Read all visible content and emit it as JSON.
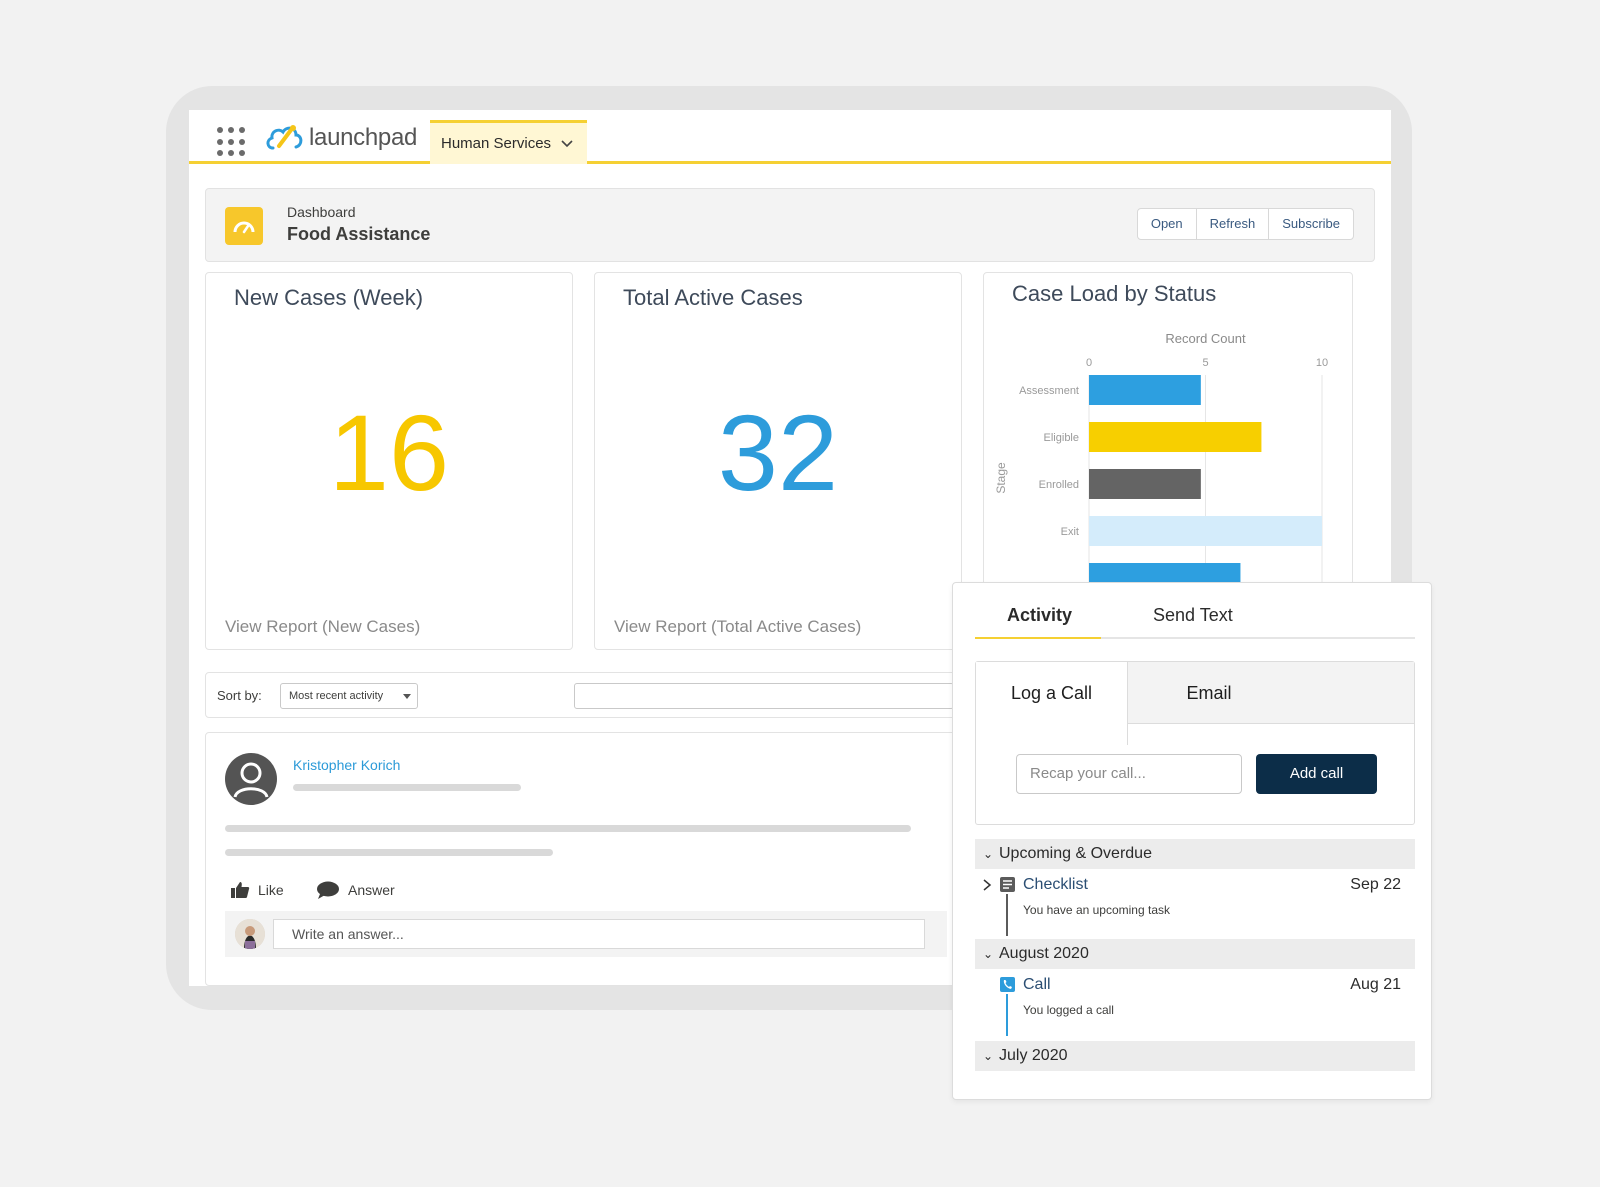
{
  "header": {
    "logo_text": "launchpad",
    "app_tab": "Human Services"
  },
  "dashboard": {
    "subtitle": "Dashboard",
    "title": "Food Assistance",
    "buttons": [
      "Open",
      "Refresh",
      "Subscribe"
    ]
  },
  "metrics": [
    {
      "title": "New Cases (Week)",
      "value": "16",
      "link": "View Report (New Cases)",
      "color": "#f7c700"
    },
    {
      "title": "Total Active Cases",
      "value": "32",
      "link": "View Report (Total Active Cases)",
      "color": "#2d9cdb"
    }
  ],
  "chart_data": {
    "type": "bar",
    "orientation": "horizontal",
    "title": "Case Load by Status",
    "xlabel": "Record Count",
    "ylabel": "Stage",
    "xlim": [
      0,
      10
    ],
    "xticks": [
      "0",
      "5",
      "10"
    ],
    "categories": [
      "Assessment",
      "Eligible",
      "Enrolled",
      "Exit",
      ""
    ],
    "values": [
      4.8,
      7.4,
      4.8,
      10,
      6.5
    ],
    "colors": [
      "#2d9fe0",
      "#f7cf00",
      "#646464",
      "#d4ecfb",
      "#2d9fe0"
    ],
    "grid": true
  },
  "feed": {
    "sort_label": "Sort by:",
    "sort_value": "Most recent activity",
    "author": "Kristopher Korich",
    "like": "Like",
    "answer": "Answer",
    "answer_placeholder": "Write an answer..."
  },
  "activity": {
    "tabs": [
      "Activity",
      "Send Text"
    ],
    "composer_tabs": [
      "Log a Call",
      "Email"
    ],
    "recap_placeholder": "Recap your call...",
    "add_button": "Add call",
    "sections": [
      {
        "label": "Upcoming & Overdue",
        "item": {
          "title": "Checklist",
          "sub": "You have an upcoming task",
          "date": "Sep 22"
        }
      },
      {
        "label": "August 2020",
        "item": {
          "title": "Call",
          "sub": "You logged a call",
          "date": "Aug 21"
        }
      },
      {
        "label": "July 2020"
      }
    ]
  }
}
